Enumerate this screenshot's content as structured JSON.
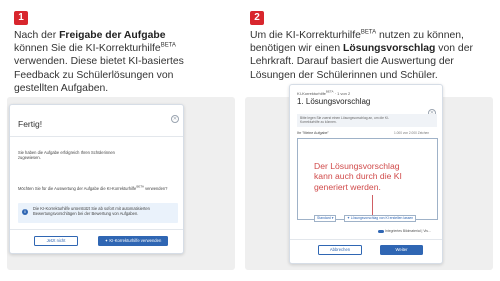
{
  "step1": {
    "number": "1",
    "pre": "Nach der ",
    "bold": "Freigabe der Aufgabe",
    "line2_a": "können Sie die KI-Korrekturhilfe",
    "beta": "BETA",
    "line3": "verwenden. Diese bietet KI-basiertes",
    "line4": "Feedback zu Schülerlösungen von",
    "line5": "gestellten Aufgaben."
  },
  "step2": {
    "number": "2",
    "line1_a": "Um die KI-Korrekturhilfe",
    "beta": "BETA",
    "line1_b": " nutzen zu können,",
    "line2_a": "benötigen wir einen ",
    "bold": "Lösungsvorschlag",
    "line2_b": " von der",
    "line3": "Lehrkraft. Darauf basiert die Auswertung der",
    "line4": "Lösungen der Schülerinnen und Schüler."
  },
  "dialog1": {
    "title": "Fertig!",
    "body": "Sie haben die Aufgabe erfolgreich Ihren Schülerinnen zugewiesen.",
    "question": "Möchten Sie für die Auswertung der Aufgabe die KI-Korrekturhilfe",
    "question_sup": "BETA",
    "question_end": "verwenden?",
    "info": "Die KI-Korrekturhilfe unterstützt Sie ab sofort mit automatisierten Bewertungsvorschlägen bei der Bewertung von Aufgaben.",
    "btn_secondary": "Jetzt nicht",
    "btn_primary": "KI-Korrekturhilfe verwenden"
  },
  "dialog2": {
    "crumb": "KI-Korrekturhilfe",
    "crumb_sup": "BETA",
    "crumb_step": " · 1 von 2",
    "heading": "1. Lösungsvorschlag",
    "note": "Bitte legen Sie zuerst einen Lösungsvorschlag an, um die KI-Korrekturhilfe zu können.",
    "field_label": "Ihr \"Meine Aufgabe\"",
    "counter": "1.000 von 2.000 Zeichen",
    "hint": "Der Lösungsvorschlag kann auch durch die KI generiert werden.",
    "mini_btn_a": "Standard ▾",
    "mini_btn_b": "Lösungsvorschlag von KI erstellen lassen",
    "footer_note": "Integriertes Bildmaterial | Vis...",
    "btn_secondary": "Abbrechen",
    "btn_primary": "Weiter"
  },
  "colors": {
    "accent": "#d8262d",
    "primary": "#2f66b3",
    "hint": "#d04a4a"
  }
}
